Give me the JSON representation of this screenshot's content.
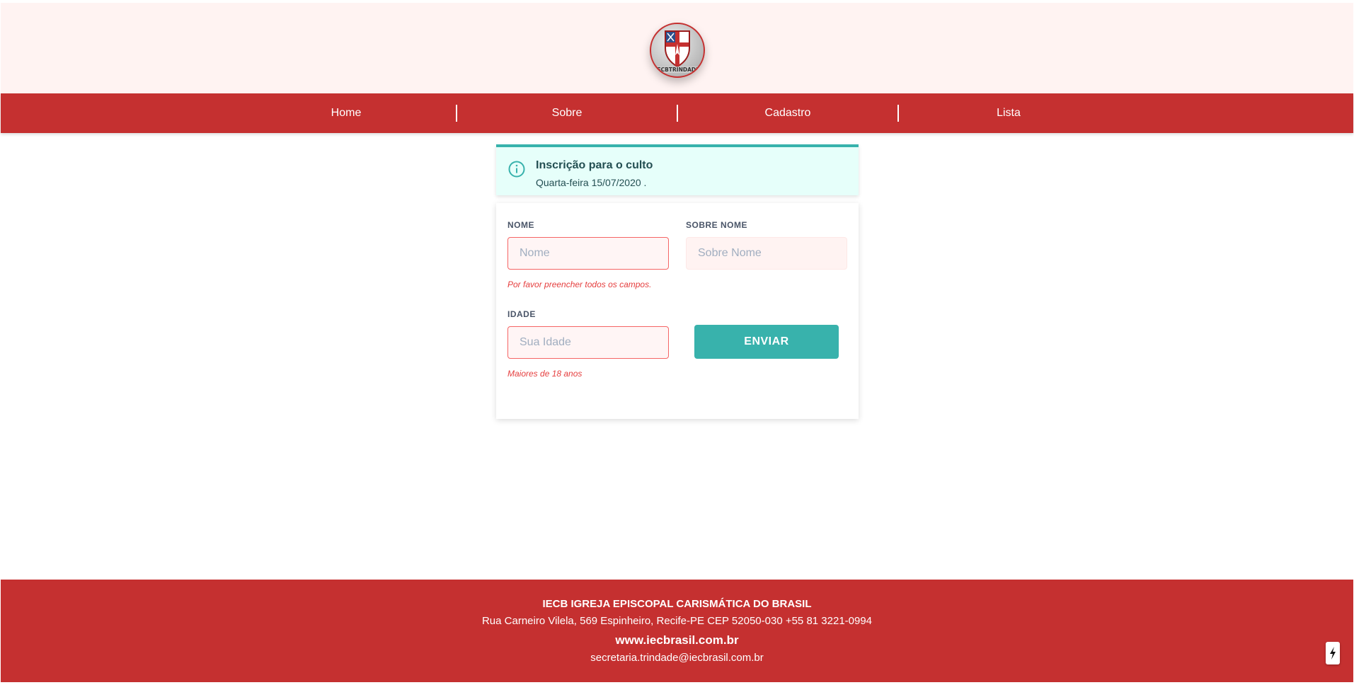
{
  "logo": {
    "text": "IECBTRINDADE",
    "ring_color": "#c53030"
  },
  "nav": {
    "items": [
      {
        "label": "Home"
      },
      {
        "label": "Sobre"
      },
      {
        "label": "Cadastro"
      },
      {
        "label": "Lista"
      }
    ]
  },
  "alert": {
    "icon": "info-circle-icon",
    "title": "Inscrição para o culto",
    "text": "Quarta-feira 15/07/2020 ."
  },
  "form": {
    "nome": {
      "label": "NOME",
      "placeholder": "Nome",
      "value": ""
    },
    "sobrenome": {
      "label": "SOBRE NOME",
      "placeholder": "Sobre Nome",
      "value": ""
    },
    "nome_error": "Por favor preencher todos os campos.",
    "idade": {
      "label": "IDADE",
      "placeholder": "Sua Idade",
      "value": ""
    },
    "idade_hint": "Maiores de 18 anos",
    "submit_label": "ENVIAR"
  },
  "footer": {
    "org": "IECB IGREJA EPISCOPAL CARISMÁTICA DO BRASIL",
    "address": "Rua Carneiro Vilela, 569 Espinheiro, Recife-PE CEP 52050-030 +55 81 3221-0994",
    "website": "www.iecbrasil.com.br",
    "email": "secretaria.trindade@iecbrasil.com.br"
  },
  "floating_button": {
    "icon": "lightning-bolt-icon"
  },
  "colors": {
    "brand_red": "#c53030",
    "accent_teal": "#38b2ac",
    "header_bg": "#fff3f2",
    "alert_bg": "#e6fffa",
    "error": "#e53e3e"
  }
}
